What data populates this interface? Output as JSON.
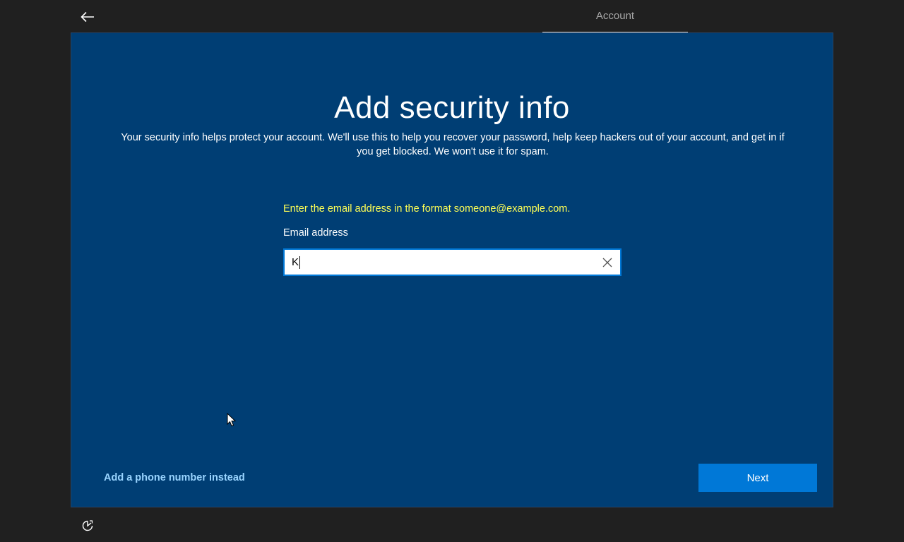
{
  "header": {
    "back_icon": "arrow-left-icon",
    "tab_label": "Account"
  },
  "main": {
    "title": "Add security info",
    "description": "Your security info helps protect your account. We'll use this to help you recover your password, help keep hackers out of your account, and get in if you get blocked. We won't use it for spam.",
    "error_message": "Enter the email address in the format someone@example.com.",
    "email_label": "Email address",
    "email_value": "K",
    "clear_icon": "close-icon"
  },
  "footer": {
    "alt_link": "Add a phone number instead",
    "next_label": "Next",
    "accessibility_icon": "ease-of-access-icon"
  },
  "colors": {
    "background": "#202020",
    "panel": "#003e74",
    "accent": "#0078d7",
    "error": "#ffff55",
    "link": "#99d4ff"
  }
}
